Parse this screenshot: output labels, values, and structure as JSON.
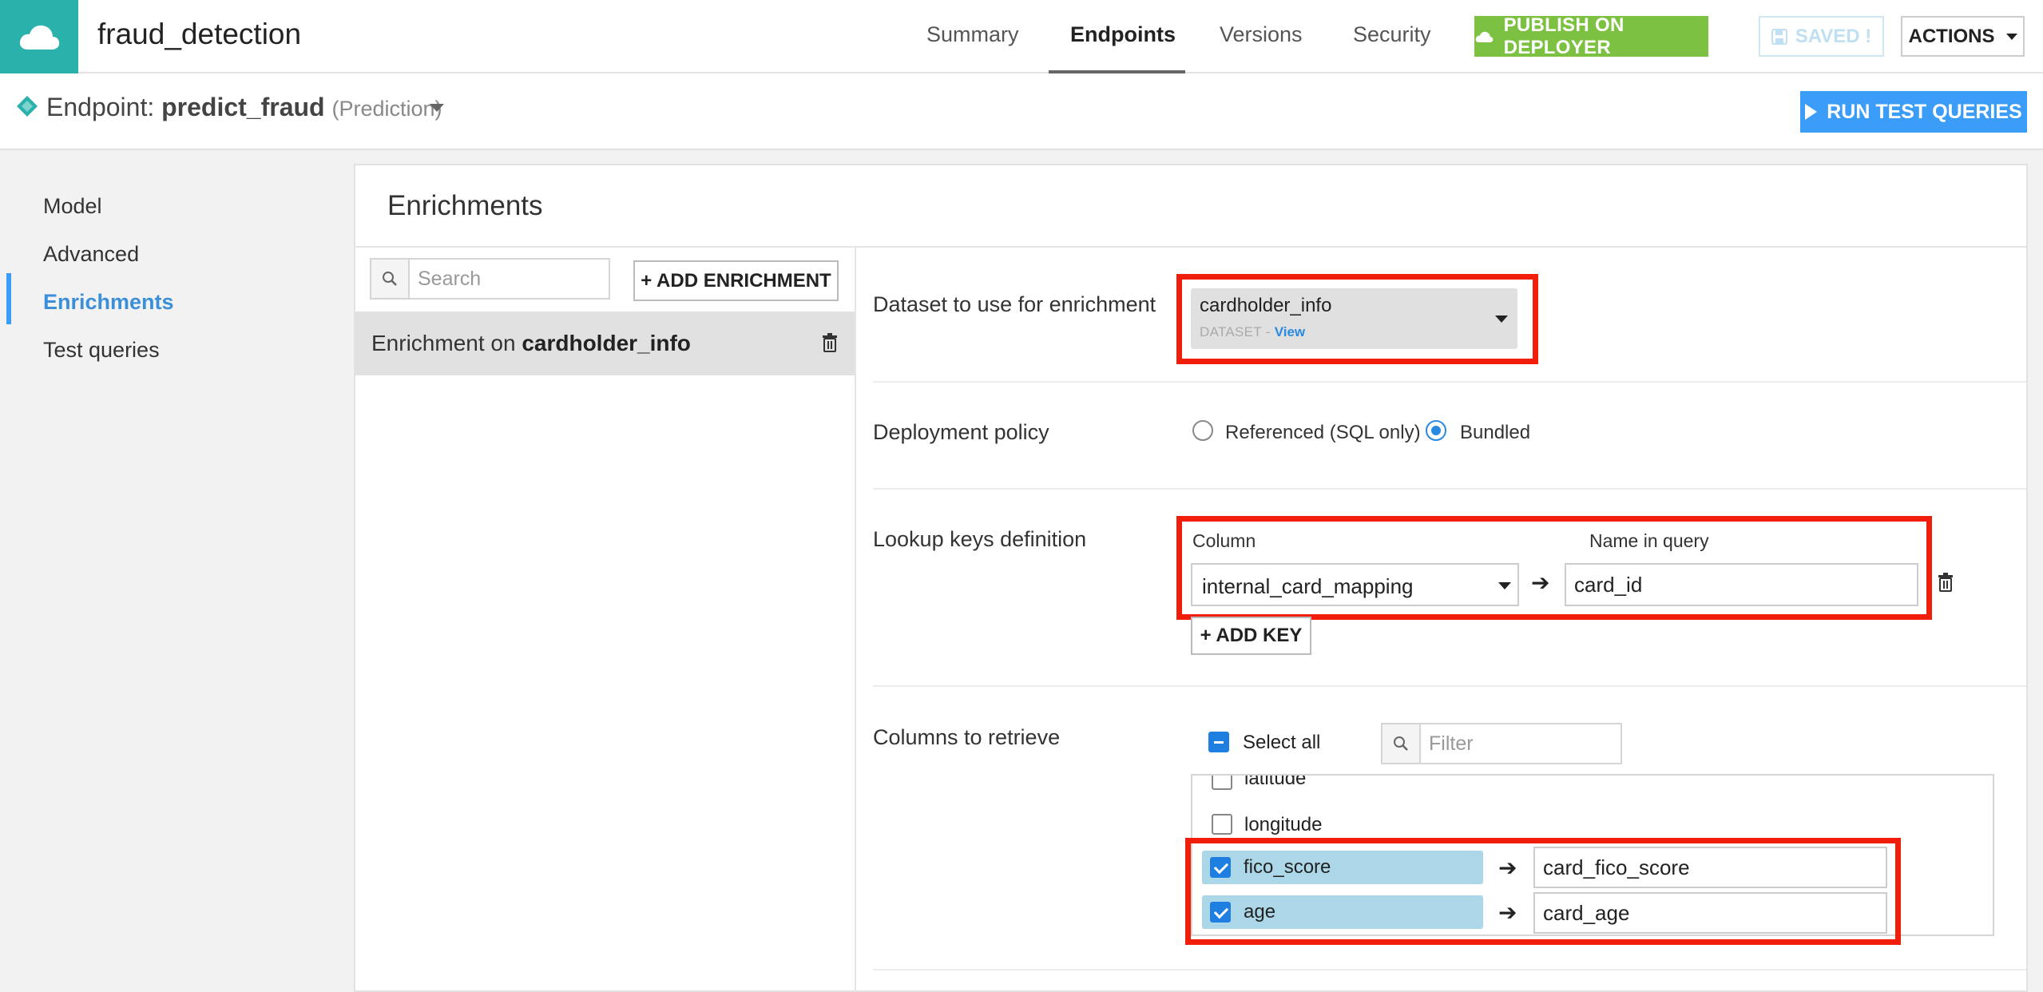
{
  "app": {
    "title": "fraud_detection"
  },
  "nav": {
    "tabs": [
      {
        "label": "Summary"
      },
      {
        "label": "Endpoints"
      },
      {
        "label": "Versions"
      },
      {
        "label": "Security"
      }
    ],
    "active_tab": "Endpoints",
    "publish_label": "PUBLISH ON DEPLOYER",
    "saved_label": "SAVED !",
    "actions_label": "ACTIONS"
  },
  "endpoint": {
    "prefix": "Endpoint:",
    "name": "predict_fraud",
    "type": "(Prediction)",
    "run_label": "RUN TEST QUERIES"
  },
  "sidebar": {
    "items": [
      {
        "label": "Model"
      },
      {
        "label": "Advanced"
      },
      {
        "label": "Enrichments"
      },
      {
        "label": "Test queries"
      }
    ],
    "active": "Enrichments"
  },
  "enrichments": {
    "title": "Enrichments",
    "search_placeholder": "Search",
    "add_label": "+ ADD ENRICHMENT",
    "items": [
      {
        "prefix": "Enrichment on",
        "dataset": "cardholder_info"
      }
    ]
  },
  "form": {
    "dataset": {
      "label": "Dataset to use for enrichment",
      "value": "cardholder_info",
      "type_tag": "DATASET",
      "separator": "-",
      "view_link": "View"
    },
    "deployment": {
      "label": "Deployment policy",
      "options": [
        {
          "label": "Referenced (SQL only)",
          "selected": false
        },
        {
          "label": "Bundled",
          "selected": true
        }
      ]
    },
    "lookup": {
      "label": "Lookup keys definition",
      "column_header": "Column",
      "name_header": "Name in query",
      "keys": [
        {
          "column": "internal_card_mapping",
          "name": "card_id"
        }
      ],
      "add_key_label": "+ ADD KEY"
    },
    "columns": {
      "label": "Columns to retrieve",
      "select_all_label": "Select all",
      "filter_placeholder": "Filter",
      "list": [
        {
          "name": "latitude",
          "checked": false
        },
        {
          "name": "longitude",
          "checked": false
        },
        {
          "name": "fico_score",
          "checked": true,
          "alias": "card_fico_score"
        },
        {
          "name": "age",
          "checked": true,
          "alias": "card_age"
        }
      ]
    }
  },
  "colors": {
    "brand": "#2ab1ac",
    "publish": "#7cc142",
    "primary": "#3b9df8",
    "highlight_box": "#f01e0a",
    "selected_chip": "#acd7e8"
  }
}
